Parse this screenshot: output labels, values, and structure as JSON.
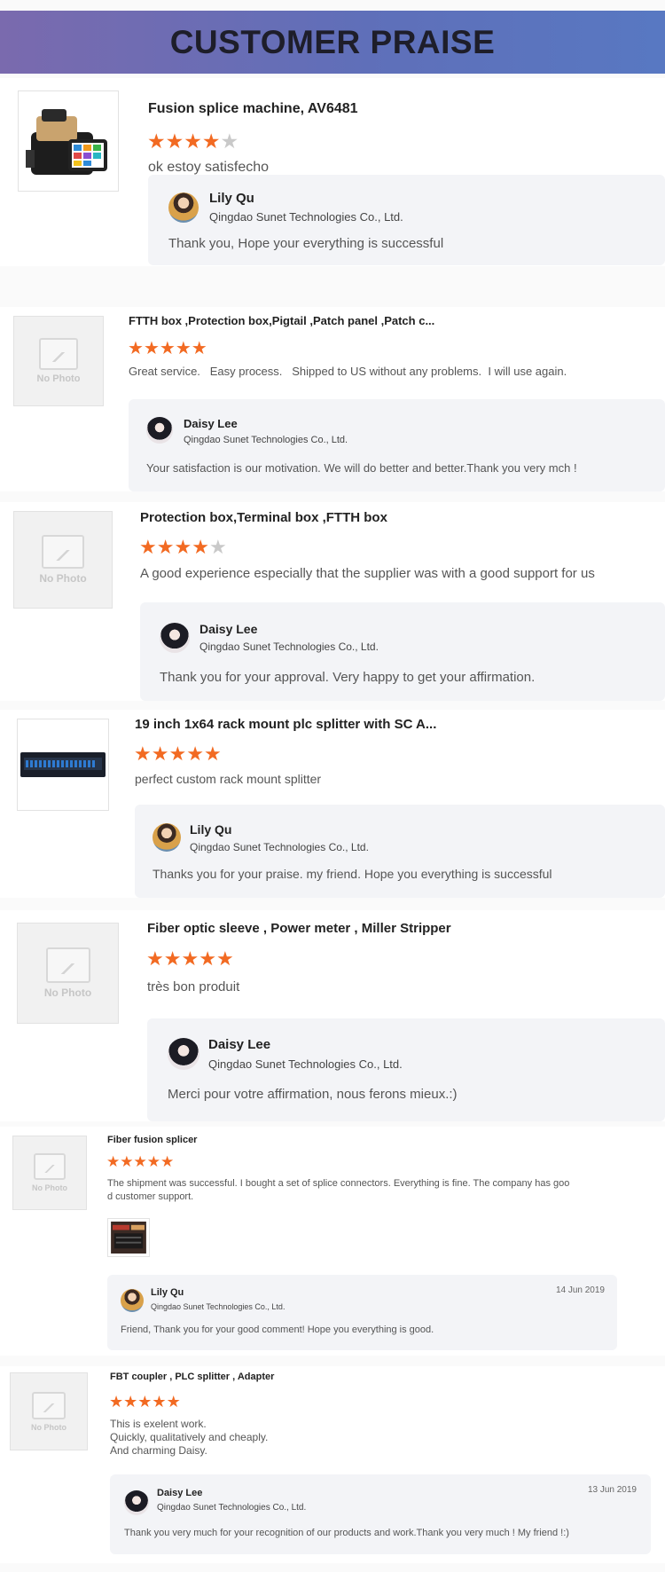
{
  "header": {
    "title": "CUSTOMER PRAISE"
  },
  "no_photo_label": "No Photo",
  "colors": {
    "star_on": "#f26a22",
    "star_off": "#c9c9c9",
    "banner_start": "#7a6aae",
    "banner_end": "#5878c2"
  },
  "reviews": [
    {
      "product": "Fusion splice machine, AV6481",
      "rating": 4,
      "image": "fusion-splicer-photo",
      "comment": "ok estoy satisfecho",
      "reply": {
        "name": "Lily Qu",
        "company": "Qingdao Sunet Technologies Co., Ltd.",
        "text": "Thank you, Hope your everything is successful",
        "date": ""
      }
    },
    {
      "product": "FTTH box ,Protection box,Pigtail ,Patch panel ,Patch c...",
      "rating": 5,
      "image": "no-photo",
      "comment": "Great service.   Easy process.   Shipped to US without any problems.  I will use again.",
      "reply": {
        "name": "Daisy Lee",
        "company": "Qingdao Sunet Technologies Co., Ltd.",
        "text": "Your satisfaction is our motivation. We will do better and better.Thank you very mch !",
        "date": ""
      }
    },
    {
      "product": "Protection box,Terminal box ,FTTH box",
      "rating": 4,
      "image": "no-photo",
      "comment": "A good experience especially that the supplier was with a good support for us",
      "reply": {
        "name": "Daisy Lee",
        "company": "Qingdao Sunet Technologies Co., Ltd.",
        "text": "Thank you for your approval. Very happy to get your affirmation.",
        "date": ""
      }
    },
    {
      "product": "19 inch 1x64 rack mount plc splitter with SC A...",
      "rating": 5,
      "image": "rack-splitter-photo",
      "comment": "perfect custom rack mount splitter",
      "reply": {
        "name": "Lily Qu",
        "company": "Qingdao Sunet Technologies Co., Ltd.",
        "text": "Thanks you for your praise. my friend. Hope you everything is successful",
        "date": ""
      }
    },
    {
      "product": "Fiber optic sleeve , Power meter , Miller Stripper",
      "rating": 5,
      "image": "no-photo",
      "comment": "très bon produit",
      "reply": {
        "name": "Daisy Lee",
        "company": "Qingdao Sunet Technologies Co., Ltd.",
        "text": "Merci pour votre affirmation, nous ferons mieux.:)",
        "date": ""
      }
    },
    {
      "product": "Fiber fusion splicer",
      "rating": 5,
      "image": "no-photo",
      "comment_lines": [
        "The shipment was successful. I bought a set of splice connectors. Everything is fine. The company has goo",
        "d customer support."
      ],
      "attachment": "splice-connectors-photo",
      "reply": {
        "name": "Lily Qu",
        "company": "Qingdao Sunet Technologies Co., Ltd.",
        "text": "Friend, Thank you for your good comment! Hope you everything is good.",
        "date": "14 Jun 2019"
      }
    },
    {
      "product": "FBT coupler , PLC splitter , Adapter",
      "rating": 5,
      "image": "no-photo",
      "comment_lines": [
        "This is exelent work.",
        "Quickly, qualitatively and cheaply.",
        "And charming Daisy."
      ],
      "reply": {
        "name": "Daisy Lee",
        "company": "Qingdao Sunet Technologies Co., Ltd.",
        "text": "Thank you very much for your recognition of our products and work.Thank you very much ! My friend !:)",
        "date": "13 Jun 2019"
      }
    }
  ]
}
